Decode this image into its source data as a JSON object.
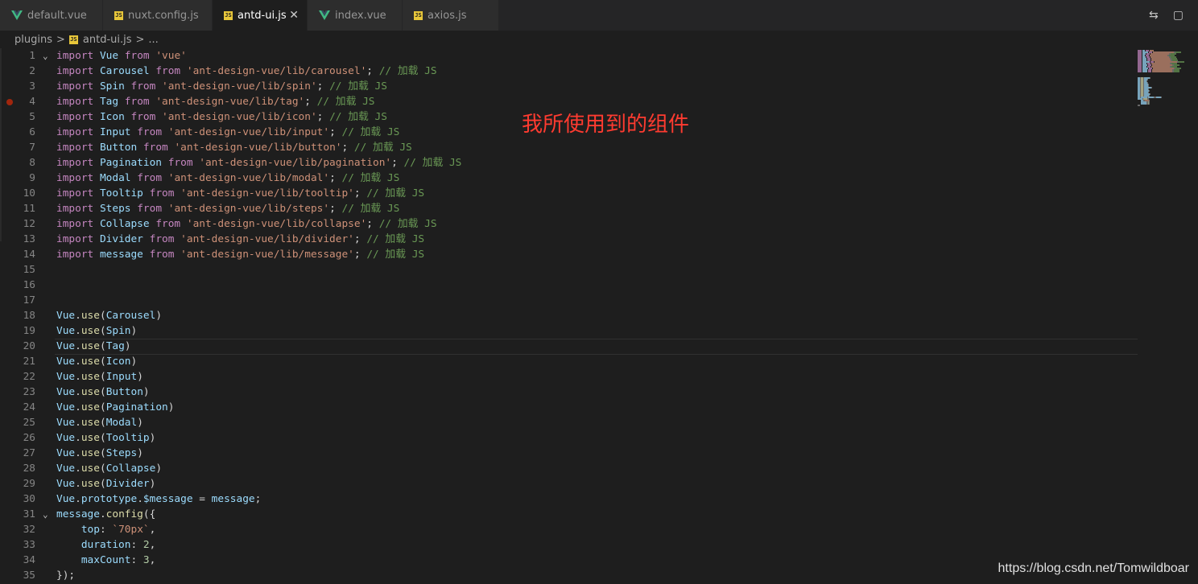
{
  "tabs": [
    {
      "label": "default.vue",
      "icon": "vue-icon",
      "active": false
    },
    {
      "label": "nuxt.config.js",
      "icon": "js-icon",
      "active": false
    },
    {
      "label": "antd-ui.js",
      "icon": "js-icon",
      "active": true
    },
    {
      "label": "index.vue",
      "icon": "vue-icon",
      "active": false
    },
    {
      "label": "axios.js",
      "icon": "js-icon",
      "active": false
    }
  ],
  "js_icon_text": "JS",
  "close_glyph": "✕",
  "breadcrumb": {
    "folder": "plugins",
    "file": "antd-ui.js",
    "more": "...",
    "sep": ">"
  },
  "annotation": "我所使用到的组件",
  "watermark": "https://blog.csdn.net/Tomwildboar",
  "colors": {
    "background": "#1e1e1e",
    "keyword": "#c586c0",
    "identifier": "#9cdcfe",
    "string": "#ce9178",
    "comment": "#6a9955",
    "annotation": "#ff3b30"
  },
  "editor": {
    "current_line": 20,
    "breakpoint_line": 4,
    "lines": [
      {
        "n": "1",
        "fold": true,
        "tokens": [
          [
            "kw",
            "import"
          ],
          [
            "pn",
            " "
          ],
          [
            "id",
            "Vue"
          ],
          [
            "pn",
            " "
          ],
          [
            "kw",
            "from"
          ],
          [
            "pn",
            " "
          ],
          [
            "str",
            "'vue'"
          ]
        ]
      },
      {
        "n": "2",
        "tokens": [
          [
            "kw",
            "import"
          ],
          [
            "pn",
            " "
          ],
          [
            "id",
            "Carousel"
          ],
          [
            "pn",
            " "
          ],
          [
            "kw",
            "from"
          ],
          [
            "pn",
            " "
          ],
          [
            "str",
            "'ant-design-vue/lib/carousel'"
          ],
          [
            "pn",
            "; "
          ],
          [
            "cm",
            "// 加载 JS"
          ]
        ]
      },
      {
        "n": "3",
        "tokens": [
          [
            "kw",
            "import"
          ],
          [
            "pn",
            " "
          ],
          [
            "id",
            "Spin"
          ],
          [
            "pn",
            " "
          ],
          [
            "kw",
            "from"
          ],
          [
            "pn",
            " "
          ],
          [
            "str",
            "'ant-design-vue/lib/spin'"
          ],
          [
            "pn",
            "; "
          ],
          [
            "cm",
            "// 加载 JS"
          ]
        ]
      },
      {
        "n": "4",
        "tokens": [
          [
            "kw",
            "import"
          ],
          [
            "pn",
            " "
          ],
          [
            "id",
            "Tag"
          ],
          [
            "pn",
            " "
          ],
          [
            "kw",
            "from"
          ],
          [
            "pn",
            " "
          ],
          [
            "str",
            "'ant-design-vue/lib/tag'"
          ],
          [
            "pn",
            "; "
          ],
          [
            "cm",
            "// 加载 JS"
          ]
        ]
      },
      {
        "n": "5",
        "tokens": [
          [
            "kw",
            "import"
          ],
          [
            "pn",
            " "
          ],
          [
            "id",
            "Icon"
          ],
          [
            "pn",
            " "
          ],
          [
            "kw",
            "from"
          ],
          [
            "pn",
            " "
          ],
          [
            "str",
            "'ant-design-vue/lib/icon'"
          ],
          [
            "pn",
            "; "
          ],
          [
            "cm",
            "// 加载 JS"
          ]
        ]
      },
      {
        "n": "6",
        "tokens": [
          [
            "kw",
            "import"
          ],
          [
            "pn",
            " "
          ],
          [
            "id",
            "Input"
          ],
          [
            "pn",
            " "
          ],
          [
            "kw",
            "from"
          ],
          [
            "pn",
            " "
          ],
          [
            "str",
            "'ant-design-vue/lib/input'"
          ],
          [
            "pn",
            "; "
          ],
          [
            "cm",
            "// 加载 JS"
          ]
        ]
      },
      {
        "n": "7",
        "tokens": [
          [
            "kw",
            "import"
          ],
          [
            "pn",
            " "
          ],
          [
            "id",
            "Button"
          ],
          [
            "pn",
            " "
          ],
          [
            "kw",
            "from"
          ],
          [
            "pn",
            " "
          ],
          [
            "str",
            "'ant-design-vue/lib/button'"
          ],
          [
            "pn",
            "; "
          ],
          [
            "cm",
            "// 加载 JS"
          ]
        ]
      },
      {
        "n": "8",
        "tokens": [
          [
            "kw",
            "import"
          ],
          [
            "pn",
            " "
          ],
          [
            "id",
            "Pagination"
          ],
          [
            "pn",
            " "
          ],
          [
            "kw",
            "from"
          ],
          [
            "pn",
            " "
          ],
          [
            "str",
            "'ant-design-vue/lib/pagination'"
          ],
          [
            "pn",
            "; "
          ],
          [
            "cm",
            "// 加载 JS"
          ]
        ]
      },
      {
        "n": "9",
        "tokens": [
          [
            "kw",
            "import"
          ],
          [
            "pn",
            " "
          ],
          [
            "id",
            "Modal"
          ],
          [
            "pn",
            " "
          ],
          [
            "kw",
            "from"
          ],
          [
            "pn",
            " "
          ],
          [
            "str",
            "'ant-design-vue/lib/modal'"
          ],
          [
            "pn",
            "; "
          ],
          [
            "cm",
            "// 加载 JS"
          ]
        ]
      },
      {
        "n": "10",
        "tokens": [
          [
            "kw",
            "import"
          ],
          [
            "pn",
            " "
          ],
          [
            "id",
            "Tooltip"
          ],
          [
            "pn",
            " "
          ],
          [
            "kw",
            "from"
          ],
          [
            "pn",
            " "
          ],
          [
            "str",
            "'ant-design-vue/lib/tooltip'"
          ],
          [
            "pn",
            "; "
          ],
          [
            "cm",
            "// 加载 JS"
          ]
        ]
      },
      {
        "n": "11",
        "tokens": [
          [
            "kw",
            "import"
          ],
          [
            "pn",
            " "
          ],
          [
            "id",
            "Steps"
          ],
          [
            "pn",
            " "
          ],
          [
            "kw",
            "from"
          ],
          [
            "pn",
            " "
          ],
          [
            "str",
            "'ant-design-vue/lib/steps'"
          ],
          [
            "pn",
            "; "
          ],
          [
            "cm",
            "// 加载 JS"
          ]
        ]
      },
      {
        "n": "12",
        "tokens": [
          [
            "kw",
            "import"
          ],
          [
            "pn",
            " "
          ],
          [
            "id",
            "Collapse"
          ],
          [
            "pn",
            " "
          ],
          [
            "kw",
            "from"
          ],
          [
            "pn",
            " "
          ],
          [
            "str",
            "'ant-design-vue/lib/collapse'"
          ],
          [
            "pn",
            "; "
          ],
          [
            "cm",
            "// 加载 JS"
          ]
        ]
      },
      {
        "n": "13",
        "tokens": [
          [
            "kw",
            "import"
          ],
          [
            "pn",
            " "
          ],
          [
            "id",
            "Divider"
          ],
          [
            "pn",
            " "
          ],
          [
            "kw",
            "from"
          ],
          [
            "pn",
            " "
          ],
          [
            "str",
            "'ant-design-vue/lib/divider'"
          ],
          [
            "pn",
            "; "
          ],
          [
            "cm",
            "// 加载 JS"
          ]
        ]
      },
      {
        "n": "14",
        "tokens": [
          [
            "kw",
            "import"
          ],
          [
            "pn",
            " "
          ],
          [
            "id",
            "message"
          ],
          [
            "pn",
            " "
          ],
          [
            "kw",
            "from"
          ],
          [
            "pn",
            " "
          ],
          [
            "str",
            "'ant-design-vue/lib/message'"
          ],
          [
            "pn",
            "; "
          ],
          [
            "cm",
            "// 加载 JS"
          ]
        ]
      },
      {
        "n": "15",
        "tokens": []
      },
      {
        "n": "16",
        "tokens": []
      },
      {
        "n": "17",
        "tokens": []
      },
      {
        "n": "18",
        "tokens": [
          [
            "id",
            "Vue"
          ],
          [
            "pn",
            "."
          ],
          [
            "fn",
            "use"
          ],
          [
            "pn",
            "("
          ],
          [
            "id",
            "Carousel"
          ],
          [
            "pn",
            ")"
          ]
        ]
      },
      {
        "n": "19",
        "tokens": [
          [
            "id",
            "Vue"
          ],
          [
            "pn",
            "."
          ],
          [
            "fn",
            "use"
          ],
          [
            "pn",
            "("
          ],
          [
            "id",
            "Spin"
          ],
          [
            "pn",
            ")"
          ]
        ]
      },
      {
        "n": "20",
        "tokens": [
          [
            "id",
            "Vue"
          ],
          [
            "pn",
            "."
          ],
          [
            "fn",
            "use"
          ],
          [
            "pn",
            "("
          ],
          [
            "id",
            "Tag"
          ],
          [
            "pn",
            ")"
          ]
        ]
      },
      {
        "n": "21",
        "tokens": [
          [
            "id",
            "Vue"
          ],
          [
            "pn",
            "."
          ],
          [
            "fn",
            "use"
          ],
          [
            "pn",
            "("
          ],
          [
            "id",
            "Icon"
          ],
          [
            "pn",
            ")"
          ]
        ]
      },
      {
        "n": "22",
        "tokens": [
          [
            "id",
            "Vue"
          ],
          [
            "pn",
            "."
          ],
          [
            "fn",
            "use"
          ],
          [
            "pn",
            "("
          ],
          [
            "id",
            "Input"
          ],
          [
            "pn",
            ")"
          ]
        ]
      },
      {
        "n": "23",
        "tokens": [
          [
            "id",
            "Vue"
          ],
          [
            "pn",
            "."
          ],
          [
            "fn",
            "use"
          ],
          [
            "pn",
            "("
          ],
          [
            "id",
            "Button"
          ],
          [
            "pn",
            ")"
          ]
        ]
      },
      {
        "n": "24",
        "tokens": [
          [
            "id",
            "Vue"
          ],
          [
            "pn",
            "."
          ],
          [
            "fn",
            "use"
          ],
          [
            "pn",
            "("
          ],
          [
            "id",
            "Pagination"
          ],
          [
            "pn",
            ")"
          ]
        ]
      },
      {
        "n": "25",
        "tokens": [
          [
            "id",
            "Vue"
          ],
          [
            "pn",
            "."
          ],
          [
            "fn",
            "use"
          ],
          [
            "pn",
            "("
          ],
          [
            "id",
            "Modal"
          ],
          [
            "pn",
            ")"
          ]
        ]
      },
      {
        "n": "26",
        "tokens": [
          [
            "id",
            "Vue"
          ],
          [
            "pn",
            "."
          ],
          [
            "fn",
            "use"
          ],
          [
            "pn",
            "("
          ],
          [
            "id",
            "Tooltip"
          ],
          [
            "pn",
            ")"
          ]
        ]
      },
      {
        "n": "27",
        "tokens": [
          [
            "id",
            "Vue"
          ],
          [
            "pn",
            "."
          ],
          [
            "fn",
            "use"
          ],
          [
            "pn",
            "("
          ],
          [
            "id",
            "Steps"
          ],
          [
            "pn",
            ")"
          ]
        ]
      },
      {
        "n": "28",
        "tokens": [
          [
            "id",
            "Vue"
          ],
          [
            "pn",
            "."
          ],
          [
            "fn",
            "use"
          ],
          [
            "pn",
            "("
          ],
          [
            "id",
            "Collapse"
          ],
          [
            "pn",
            ")"
          ]
        ]
      },
      {
        "n": "29",
        "tokens": [
          [
            "id",
            "Vue"
          ],
          [
            "pn",
            "."
          ],
          [
            "fn",
            "use"
          ],
          [
            "pn",
            "("
          ],
          [
            "id",
            "Divider"
          ],
          [
            "pn",
            ")"
          ]
        ]
      },
      {
        "n": "30",
        "tokens": [
          [
            "id",
            "Vue"
          ],
          [
            "pn",
            "."
          ],
          [
            "id",
            "prototype"
          ],
          [
            "pn",
            "."
          ],
          [
            "id",
            "$message"
          ],
          [
            "pn",
            " = "
          ],
          [
            "id",
            "message"
          ],
          [
            "pn",
            ";"
          ]
        ]
      },
      {
        "n": "31",
        "fold": true,
        "tokens": [
          [
            "id",
            "message"
          ],
          [
            "pn",
            "."
          ],
          [
            "fn",
            "config"
          ],
          [
            "pn",
            "({"
          ]
        ]
      },
      {
        "n": "32",
        "tokens": [
          [
            "pn",
            "    "
          ],
          [
            "id",
            "top"
          ],
          [
            "pn",
            ": "
          ],
          [
            "str",
            "`70px`"
          ],
          [
            "pn",
            ","
          ]
        ]
      },
      {
        "n": "33",
        "tokens": [
          [
            "pn",
            "    "
          ],
          [
            "id",
            "duration"
          ],
          [
            "pn",
            ": "
          ],
          [
            "num",
            "2"
          ],
          [
            "pn",
            ","
          ]
        ]
      },
      {
        "n": "34",
        "tokens": [
          [
            "pn",
            "    "
          ],
          [
            "id",
            "maxCount"
          ],
          [
            "pn",
            ": "
          ],
          [
            "num",
            "3"
          ],
          [
            "pn",
            ","
          ]
        ]
      },
      {
        "n": "35",
        "tokens": [
          [
            "pn",
            "});"
          ]
        ]
      }
    ]
  }
}
